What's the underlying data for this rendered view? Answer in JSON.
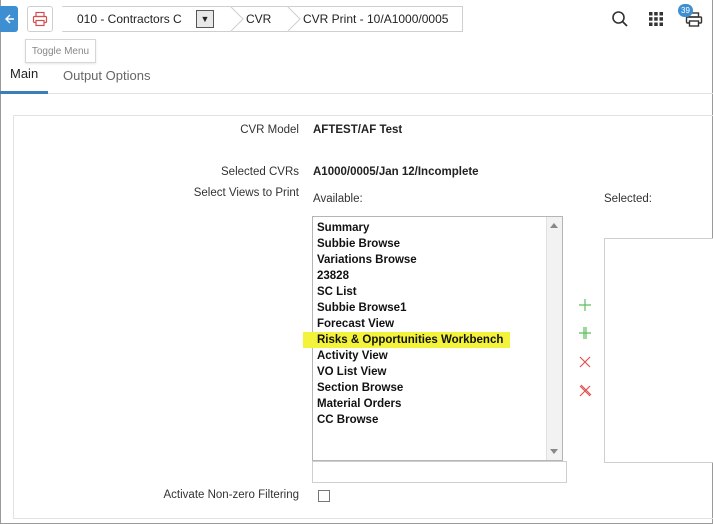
{
  "topbar": {
    "company": "010 - Contractors C",
    "crumb_cvr": "CVR",
    "crumb_print": "CVR Print - 10/A1000/0005",
    "tooltip": "Toggle Menu",
    "notification_count": "39"
  },
  "tabs": [
    {
      "label": "Main",
      "active": true
    },
    {
      "label": "Output Options",
      "active": false
    }
  ],
  "form": {
    "cvr_model_label": "CVR Model",
    "cvr_model_value": "AFTEST/AF Test",
    "selected_cvrs_label": "Selected CVRs",
    "selected_cvrs_value": "A1000/0005/Jan 12/Incomplete",
    "select_views_label": "Select Views to Print",
    "available_label": "Available:",
    "selected_label": "Selected:",
    "available_views": [
      "Summary",
      "Subbie Browse",
      "Variations Browse",
      "23828",
      "SC List",
      "Subbie Browse1",
      "Forecast View",
      "Risks & Opportunities Workbench",
      "Activity View",
      "VO List View",
      "Section Browse",
      "Material Orders",
      "CC Browse"
    ],
    "highlighted_view": "Risks & Opportunities Workbench",
    "filter_label": "Activate Non-zero Filtering",
    "filter_checked": false
  },
  "colors": {
    "accent": "#3d8fd1",
    "highlight": "#f3f33c",
    "add": "#5cbf5c",
    "remove": "#e05050"
  }
}
